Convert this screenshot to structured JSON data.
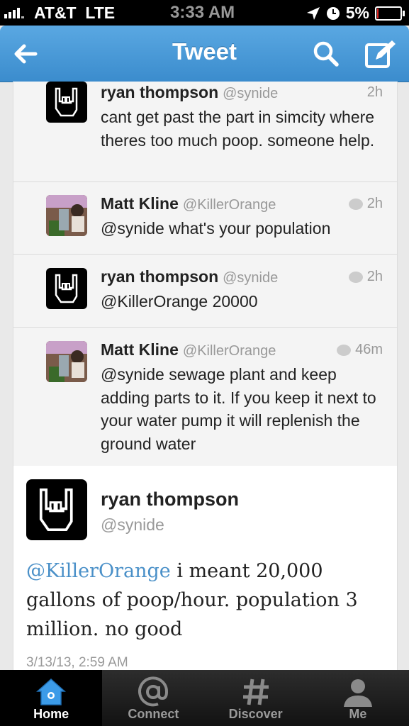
{
  "status_bar": {
    "carrier": "AT&T",
    "network": "LTE",
    "time": "3:33 AM",
    "battery": "5%",
    "battery_level": 0.05
  },
  "nav": {
    "title": "Tweet"
  },
  "conversation": [
    {
      "name": "ryan thompson",
      "handle": "@synide",
      "time": "2h",
      "text": "cant get past the part in simcity where theres too much poop. someone help.",
      "reply": false,
      "avatar": "rock-hand-icon"
    },
    {
      "name": "Matt Kline",
      "handle": "@KillerOrange",
      "time": "2h",
      "text": "@synide what's your population",
      "reply": true,
      "avatar": "matt-avatar"
    },
    {
      "name": "ryan thompson",
      "handle": "@synide",
      "time": "2h",
      "text": "@KillerOrange 20000",
      "reply": true,
      "avatar": "rock-hand-icon"
    },
    {
      "name": "Matt Kline",
      "handle": "@KillerOrange",
      "time": "46m",
      "text": "@synide sewage plant and keep adding parts to it. If you keep it next to your water pump it will replenish the ground water",
      "reply": true,
      "avatar": "matt-avatar"
    }
  ],
  "detail": {
    "name": "ryan thompson",
    "handle": "@synide",
    "mention": "@KillerOrange",
    "text": " i meant 20,000 gallons of poop/hour. population 3 million. no good",
    "date": "3/13/13, 2:59 AM"
  },
  "tabs": [
    {
      "label": "Home",
      "icon": "home-icon",
      "active": true
    },
    {
      "label": "Connect",
      "icon": "at-icon",
      "active": false
    },
    {
      "label": "Discover",
      "icon": "hash-icon",
      "active": false
    },
    {
      "label": "Me",
      "icon": "person-icon",
      "active": false
    }
  ]
}
